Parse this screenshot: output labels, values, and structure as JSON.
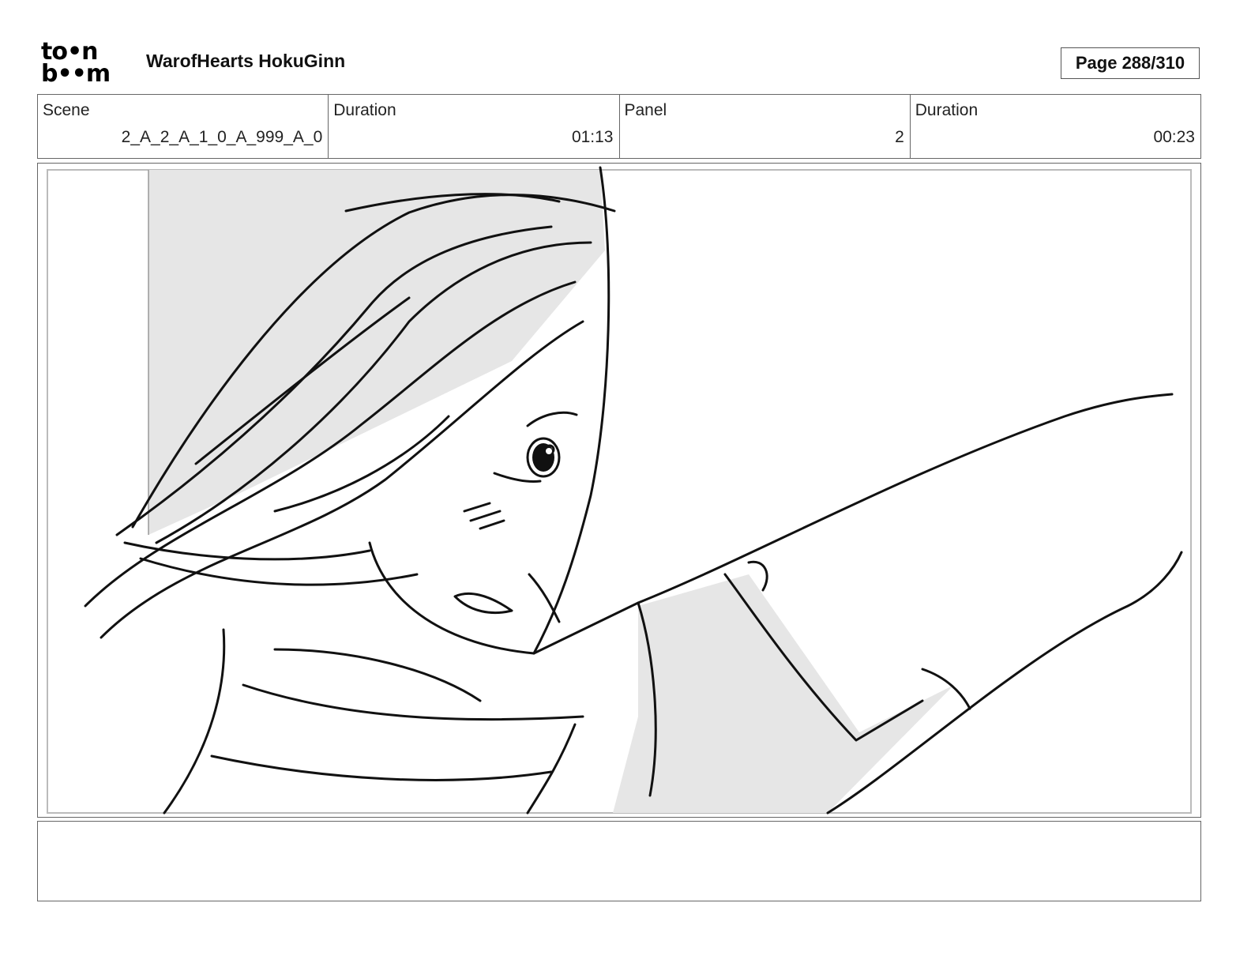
{
  "header": {
    "logo_line1": "to•n",
    "logo_line2": "b••m",
    "project_title": "WarofHearts HokuGinn",
    "page_indicator": "Page 288/310"
  },
  "info": {
    "scene_label": "Scene",
    "scene_value": "2_A_2_A_1_0_A_999_A_0",
    "scene_duration_label": "Duration",
    "scene_duration_value": "01:13",
    "panel_label": "Panel",
    "panel_value": "2",
    "panel_duration_label": "Duration",
    "panel_duration_value": "00:23"
  },
  "colors": {
    "border": "#666666",
    "sketch_stroke": "#111111",
    "shadow_fill": "#e6e6e6"
  },
  "notes": {
    "text": ""
  }
}
